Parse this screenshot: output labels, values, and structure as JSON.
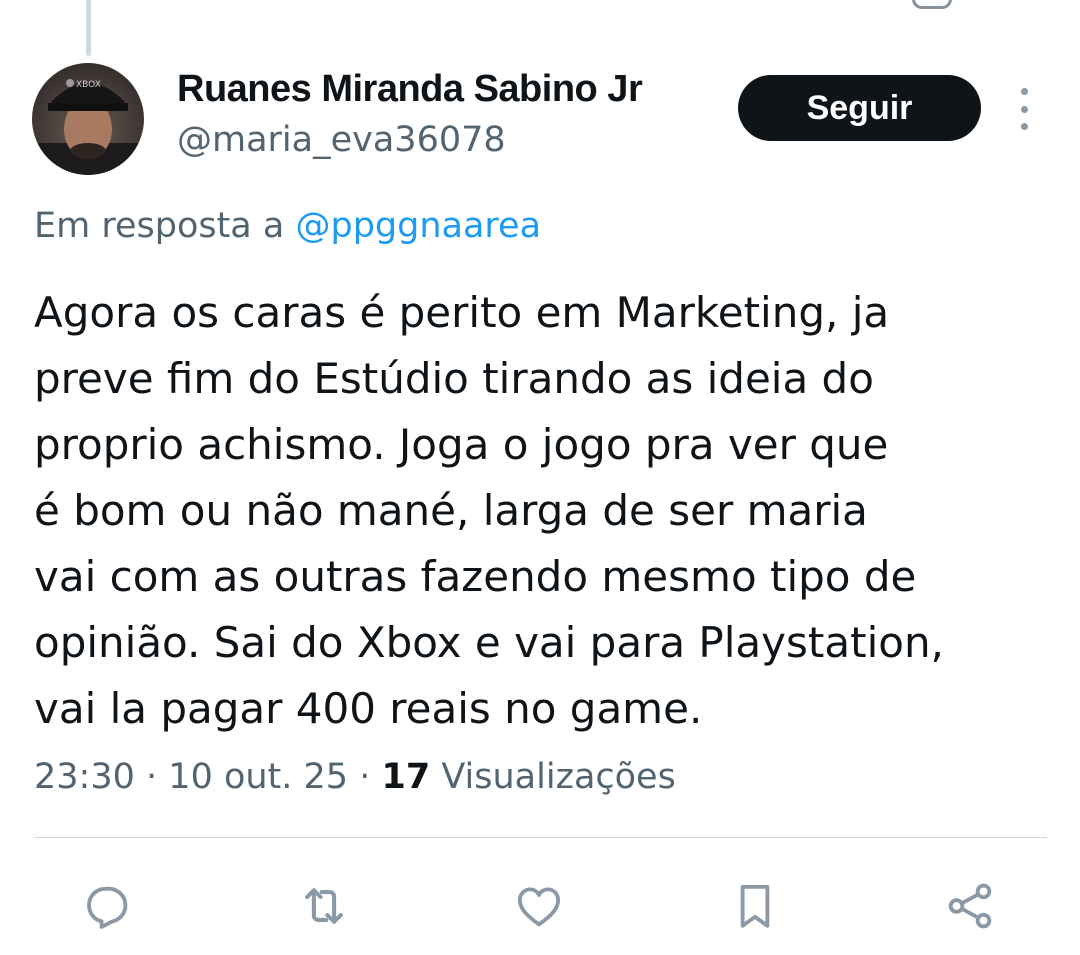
{
  "author": {
    "name": "Ruanes Miranda Sabino Jr",
    "handle": "@maria_eva36078"
  },
  "follow_label": "Seguir",
  "reply": {
    "prefix": "Em resposta a",
    "mention": "@ppggnaarea"
  },
  "tweet": {
    "lines": [
      "Agora os caras é perito em Marketing, ja",
      "preve fim do Estúdio tirando as ideia do",
      "proprio achismo. Joga o jogo pra ver que",
      "é bom ou não mané, larga de ser maria",
      "vai com as outras fazendo mesmo tipo de",
      "opinião. Sai do Xbox e vai para Playstation,",
      "vai la pagar 400 reais no game."
    ]
  },
  "meta": {
    "time": "23:30",
    "separator": "·",
    "date": "10 out. 25",
    "views_count": "17",
    "views_label": "Visualizações"
  },
  "actions": [
    "reply-icon",
    "retweet-icon",
    "like-icon",
    "bookmark-icon",
    "share-icon"
  ],
  "colors": {
    "text": "#0f1419",
    "secondary": "#536471",
    "link": "#1d9bf0",
    "divider": "#cfd9de",
    "button_bg": "#0f1419",
    "icon": "#8b98a5"
  }
}
